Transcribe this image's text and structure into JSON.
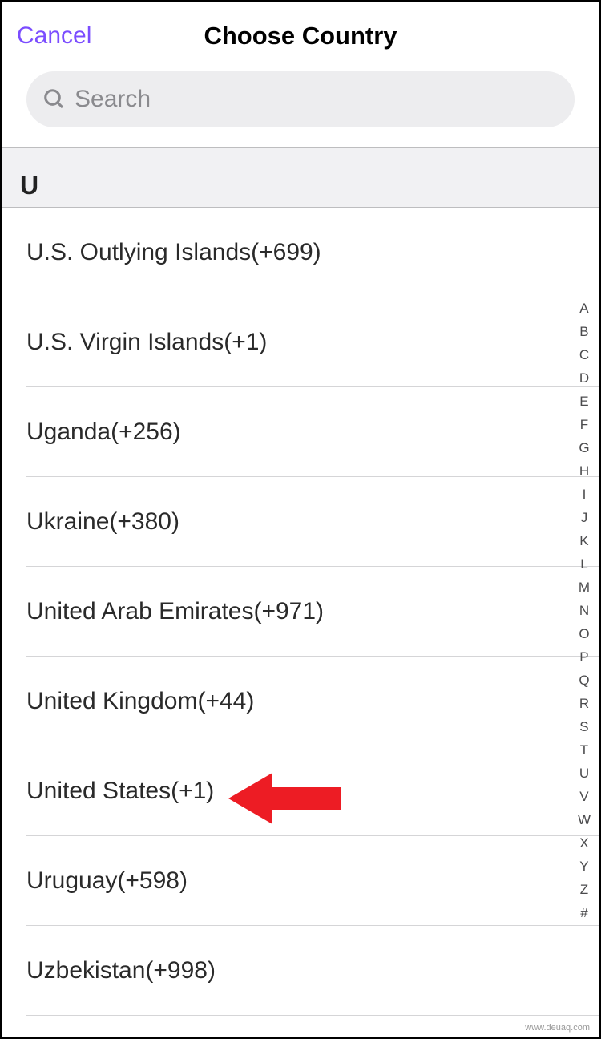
{
  "header": {
    "cancel_label": "Cancel",
    "title": "Choose Country"
  },
  "search": {
    "placeholder": "Search"
  },
  "section": {
    "letter": "U"
  },
  "countries": [
    {
      "label": "U.S. Outlying Islands(+699)"
    },
    {
      "label": "U.S. Virgin Islands(+1)"
    },
    {
      "label": "Uganda(+256)"
    },
    {
      "label": "Ukraine(+380)"
    },
    {
      "label": "United Arab Emirates(+971)"
    },
    {
      "label": "United Kingdom(+44)"
    },
    {
      "label": "United States(+1)"
    },
    {
      "label": "Uruguay(+598)"
    },
    {
      "label": "Uzbekistan(+998)"
    }
  ],
  "index": [
    "A",
    "B",
    "C",
    "D",
    "E",
    "F",
    "G",
    "H",
    "I",
    "J",
    "K",
    "L",
    "M",
    "N",
    "O",
    "P",
    "Q",
    "R",
    "S",
    "T",
    "U",
    "V",
    "W",
    "X",
    "Y",
    "Z",
    "#"
  ],
  "watermark": "www.deuaq.com"
}
